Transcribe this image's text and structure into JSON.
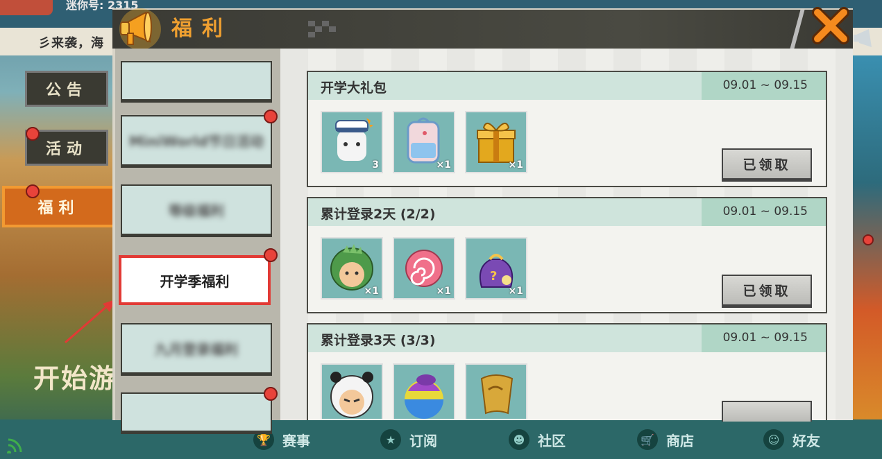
{
  "background": {
    "top_info": "迷你号: 2315",
    "marquee": "彡来袭，海",
    "start_text": "开始游"
  },
  "outer_tabs": [
    {
      "label": "公告",
      "has_dot": false
    },
    {
      "label": "活动",
      "has_dot": true
    },
    {
      "label": "福利",
      "has_dot": true,
      "active": true
    }
  ],
  "dialog": {
    "title": "福利",
    "close_icon": "close-x-icon",
    "horn_icon": "megaphone-icon"
  },
  "side_tabs": [
    {
      "label": "",
      "blurred": true,
      "has_dot": false
    },
    {
      "label": "MiniWorld节日活动",
      "blurred": true,
      "has_dot": true
    },
    {
      "label": "等级福利",
      "blurred": true,
      "has_dot": false
    },
    {
      "label": "开学季福利",
      "blurred": false,
      "has_dot": true,
      "selected": true
    },
    {
      "label": "九月登录福利",
      "blurred": true,
      "has_dot": false
    },
    {
      "label": "",
      "blurred": true,
      "has_dot": true
    }
  ],
  "cards": [
    {
      "title": "开学大礼包",
      "date": "09.01 ~ 09.15",
      "items": [
        {
          "icon": "sailor-bear-icon",
          "count": "3"
        },
        {
          "icon": "school-backpack-icon",
          "count": "×1"
        },
        {
          "icon": "gold-gift-box-icon",
          "count": "×1"
        }
      ],
      "button": "已领取"
    },
    {
      "title": "累计登录2天 (2/2)",
      "date": "09.01 ~ 09.15",
      "items": [
        {
          "icon": "dino-hood-kid-icon",
          "count": "×1"
        },
        {
          "icon": "candy-icon",
          "count": "×1"
        },
        {
          "icon": "mystery-bag-icon",
          "count": "×1"
        }
      ],
      "button": "已领取"
    },
    {
      "title": "累计登录3天 (3/3)",
      "date": "09.01 ~ 09.15",
      "items": [
        {
          "icon": "panda-hood-kid-icon",
          "count": ""
        },
        {
          "icon": "rainbow-pot-icon",
          "count": ""
        },
        {
          "icon": "gold-scroll-icon",
          "count": ""
        }
      ],
      "button": ""
    }
  ],
  "bottom_nav": [
    {
      "label": "赛事",
      "icon": "trophy-icon"
    },
    {
      "label": "订阅",
      "icon": "star-badge-icon"
    },
    {
      "label": "社区",
      "icon": "community-icon"
    },
    {
      "label": "商店",
      "icon": "shopping-cart-icon"
    },
    {
      "label": "好友",
      "icon": "friends-icon"
    }
  ],
  "colors": {
    "accent_orange": "#f0a030",
    "selection_red": "#e23a35",
    "card_header": "#cfe4dc",
    "item_bg": "#7ab7b4"
  }
}
